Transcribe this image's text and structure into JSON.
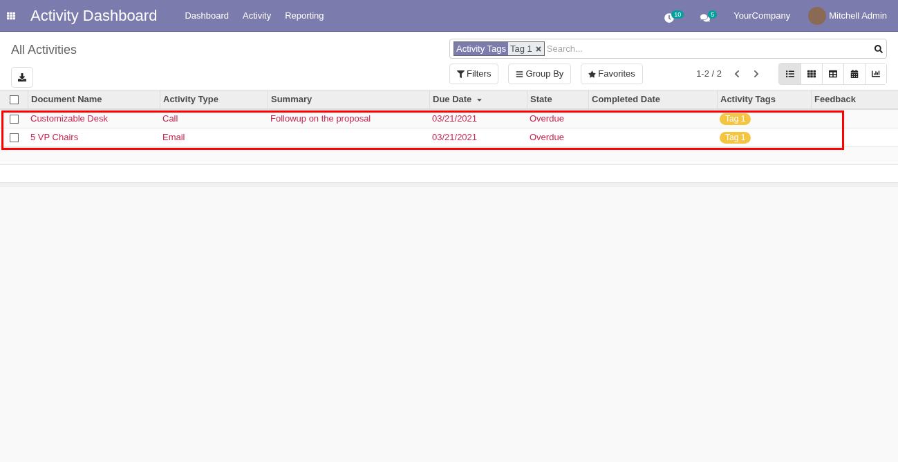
{
  "navbar": {
    "app_title": "Activity Dashboard",
    "menu": [
      "Dashboard",
      "Activity",
      "Reporting"
    ],
    "activity_count": "10",
    "message_count": "5",
    "company": "YourCompany",
    "user": "Mitchell Admin"
  },
  "control_panel": {
    "title": "All Activities",
    "search": {
      "facet_label": "Activity Tags",
      "facet_value": "Tag 1",
      "placeholder": "Search..."
    },
    "filter_buttons": [
      "Filters",
      "Group By",
      "Favorites"
    ],
    "pager": "1-2 / 2",
    "views": [
      {
        "kind": "list",
        "selected": true
      },
      {
        "kind": "kanban",
        "selected": false
      },
      {
        "kind": "pivot",
        "selected": false
      },
      {
        "kind": "calendar",
        "selected": false
      },
      {
        "kind": "graph",
        "selected": false
      }
    ]
  },
  "table": {
    "select_all_checked": false,
    "columns": [
      {
        "label": "Document Name",
        "sorted": false
      },
      {
        "label": "Activity Type",
        "sorted": false
      },
      {
        "label": "Summary",
        "sorted": false
      },
      {
        "label": "Due Date",
        "sorted": true
      },
      {
        "label": "State",
        "sorted": false
      },
      {
        "label": "Completed Date",
        "sorted": false
      },
      {
        "label": "Activity Tags",
        "sorted": false
      },
      {
        "label": "Feedback",
        "sorted": false
      }
    ],
    "rows": [
      {
        "checked": false,
        "overdue": true,
        "document_name": "Customizable Desk",
        "activity_type": "Call",
        "summary": "Followup on the proposal",
        "due_date": "03/21/2021",
        "state": "Overdue",
        "tags": [
          "Tag 1"
        ]
      },
      {
        "checked": false,
        "overdue": true,
        "document_name": "5 VP Chairs",
        "activity_type": "Email",
        "summary": "",
        "due_date": "03/21/2021",
        "state": "Overdue",
        "tags": [
          "Tag 1"
        ]
      }
    ]
  },
  "highlight": {
    "shown": true
  }
}
